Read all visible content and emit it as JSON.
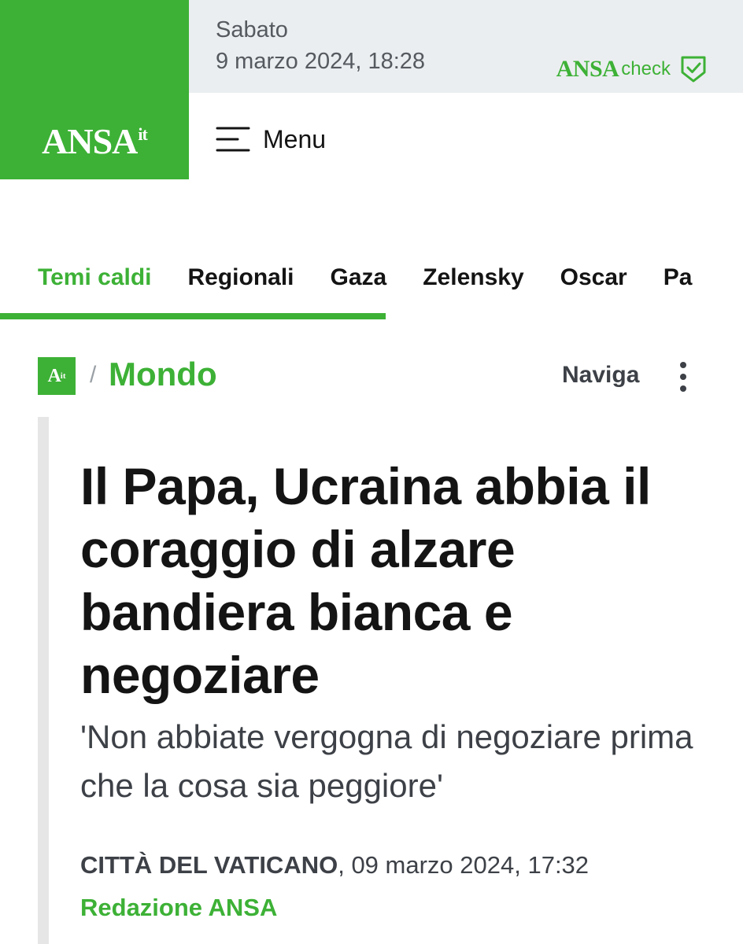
{
  "header": {
    "logo_text": "ANSA",
    "logo_suffix": "it",
    "date_day": "Sabato",
    "date_full": "9 marzo 2024, 18:28",
    "check_brand": "ANSA",
    "check_word": "check",
    "menu_label": "Menu"
  },
  "tabs": [
    {
      "label": "Temi caldi"
    },
    {
      "label": "Regionali"
    },
    {
      "label": "Gaza"
    },
    {
      "label": "Zelensky"
    },
    {
      "label": "Oscar"
    },
    {
      "label": "Pa"
    }
  ],
  "breadcrumb": {
    "logo_text": "A",
    "logo_suffix": "it",
    "separator": "/",
    "section": "Mondo",
    "naviga_label": "Naviga"
  },
  "article": {
    "headline": "Il Papa, Ucraina abbia il coraggio di alzare bandiera bianca e negoziare",
    "subtitle": "'Non abbiate vergogna di negoziare prima che la cosa sia peggiore'",
    "place": "CITTÀ DEL VATICANO",
    "date_rest": ", 09 marzo 2024, 17:32",
    "byline": "Redazione ANSA"
  },
  "colors": {
    "brand_green": "#3db136",
    "date_bar_bg": "#ebeef0"
  },
  "icons": {
    "menu": "hamburger-menu-icon",
    "check": "shield-check-icon",
    "more": "kebab-vertical-icon"
  }
}
